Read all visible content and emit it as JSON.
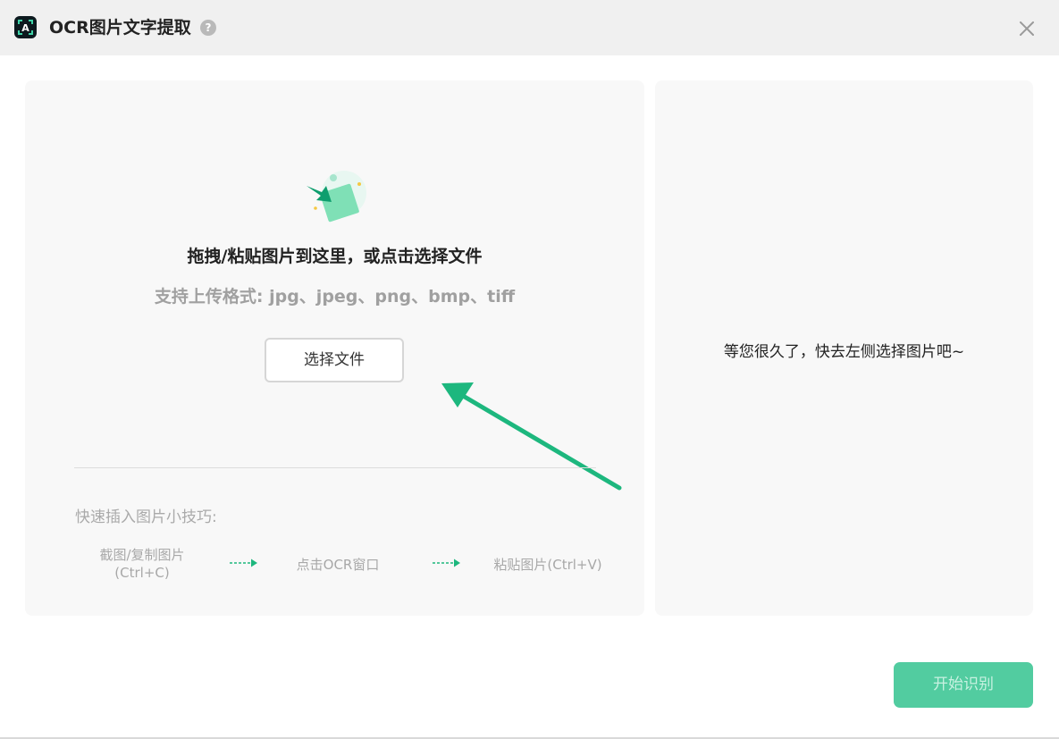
{
  "window": {
    "title": "OCR图片文字提取",
    "help_glyph": "?",
    "close_glyph": "×"
  },
  "upload": {
    "drop_title": "拖拽/粘贴图片到这里，或点击选择文件",
    "formats": "支持上传格式: jpg、jpeg、png、bmp、tiff",
    "select_button": "选择文件"
  },
  "tips": {
    "title": "快速插入图片小技巧:",
    "steps": [
      {
        "line1": "截图/复制图片",
        "line2": "(Ctrl+C)"
      },
      {
        "line1": "点击OCR窗口"
      },
      {
        "line1": "粘贴图片(Ctrl+V)"
      }
    ]
  },
  "result": {
    "placeholder": "等您很久了，快去左侧选择图片吧~"
  },
  "actions": {
    "start_button": "开始识别"
  },
  "colors": {
    "accent": "#1db77e",
    "start_button": "#52cca0",
    "panel_bg": "#f8f8f8",
    "titlebar_bg": "#f0f0f0"
  }
}
